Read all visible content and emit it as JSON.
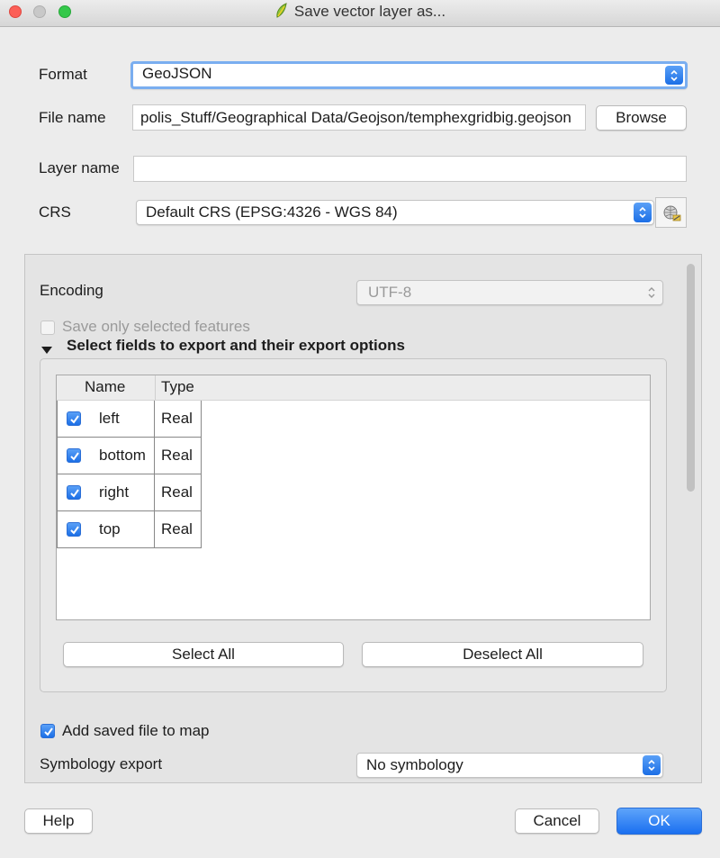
{
  "window": {
    "title": "Save vector layer as..."
  },
  "form": {
    "format_label": "Format",
    "format_value": "GeoJSON",
    "filename_label": "File name",
    "filename_value": "polis_Stuff/Geographical Data/Geojson/temphexgridbig.geojson",
    "browse_label": "Browse",
    "layername_label": "Layer name",
    "layername_value": "",
    "crs_label": "CRS",
    "crs_value": "Default CRS (EPSG:4326 - WGS 84)"
  },
  "options": {
    "encoding_label": "Encoding",
    "encoding_value": "UTF-8",
    "save_selected_label": "Save only selected features",
    "save_selected_checked": false,
    "fields_section_label": "Select fields to export and their export options",
    "table_headers": [
      "Name",
      "Type"
    ],
    "fields": [
      {
        "name": "left",
        "type": "Real",
        "checked": true
      },
      {
        "name": "bottom",
        "type": "Real",
        "checked": true
      },
      {
        "name": "right",
        "type": "Real",
        "checked": true
      },
      {
        "name": "top",
        "type": "Real",
        "checked": true
      }
    ],
    "select_all_label": "Select All",
    "deselect_all_label": "Deselect All",
    "add_to_map_label": "Add saved file to map",
    "add_to_map_checked": true,
    "symbology_label": "Symbology export",
    "symbology_value": "No symbology"
  },
  "footer": {
    "help_label": "Help",
    "cancel_label": "Cancel",
    "ok_label": "OK"
  },
  "colors": {
    "accent": "#1c6fe6",
    "focus_ring": "#7aaef0"
  }
}
